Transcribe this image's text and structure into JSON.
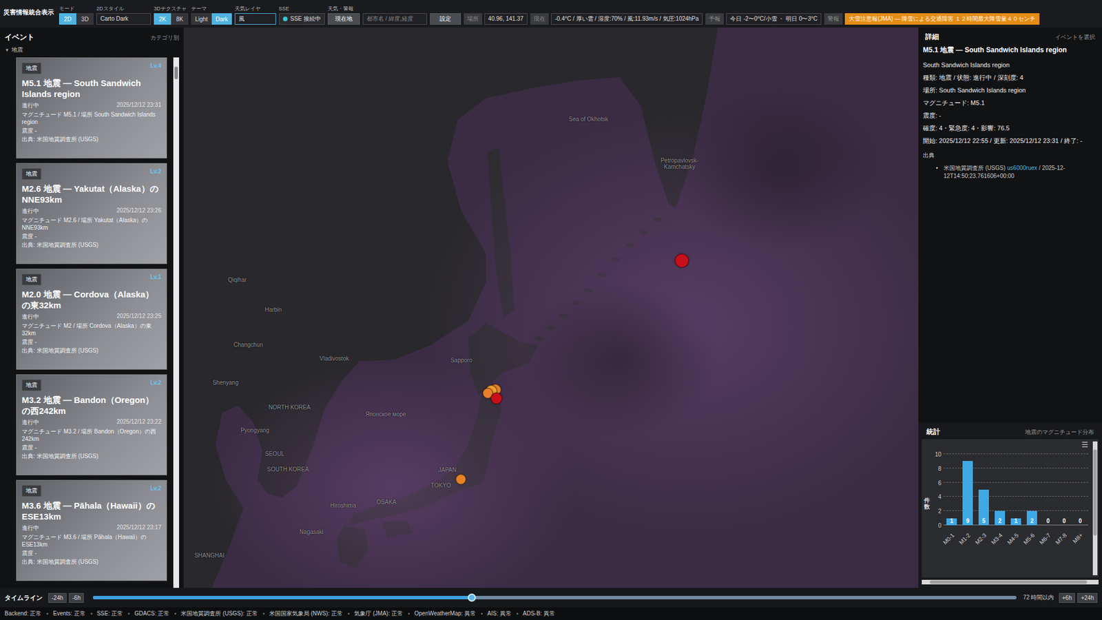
{
  "window": {
    "title": "災害情報統合表示"
  },
  "toolbar": {
    "controls": [
      {
        "kind": "toggle",
        "label": "モード",
        "options": [
          {
            "label": "2D",
            "selected": true
          },
          {
            "label": "3D",
            "selected": false
          }
        ]
      },
      {
        "kind": "select",
        "label": "2Dスタイル",
        "value": "Carto Dark"
      },
      {
        "kind": "toggle",
        "label": "3Dテクスチャ",
        "options": [
          {
            "label": "2K",
            "selected": true
          },
          {
            "label": "8K",
            "selected": false
          }
        ]
      },
      {
        "kind": "toggle",
        "label": "テーマ",
        "options": [
          {
            "label": "Light",
            "selected": false
          },
          {
            "label": "Dark",
            "selected": true
          }
        ]
      },
      {
        "kind": "input",
        "label": "天気レイヤ",
        "value": "風"
      },
      {
        "kind": "status",
        "label": "SSE",
        "value": "SSE 接続中",
        "connected": true
      }
    ],
    "weather": {
      "label": "天気・警報",
      "locateButton": "現在地",
      "placeholder": "都市名 / 緯度,経度",
      "setButton": "設定",
      "fields": [
        {
          "kind": "info",
          "label": "場所",
          "value": "40.96, 141.37"
        },
        {
          "kind": "info",
          "label": "現在",
          "value": "-0.4°C / 厚い雲 / 湿度:70% / 風:11.93m/s / 気圧:1024hPa"
        },
        {
          "kind": "info",
          "label": "予報",
          "value": "今日 -2〜0°C/小雪 ・ 明日 0〜3°C"
        },
        {
          "kind": "alert",
          "label": "警報",
          "value": "大雪注意報(JMA) — 降雪による交通障害 １２時間最大降雪量４０センチ"
        }
      ]
    }
  },
  "events": {
    "title": "イベント",
    "grouping": "カテゴリ別",
    "category": {
      "toggle": "▾",
      "label": "地震",
      "expanded": true
    },
    "items": [
      {
        "tag": "地震",
        "level": "Lv.4",
        "title": "M5.1 地震 — South Sandwich Islands region",
        "status": "進行中",
        "time": "2025/12/12 23:31",
        "detail": "マグニチュード M5.1 / 場所 South Sandwich Islands region",
        "intensity": "震度 -",
        "source": "出典: 米国地質調査所 (USGS)"
      },
      {
        "tag": "地震",
        "level": "Lv.2",
        "title": "M2.6 地震 — Yakutat（Alaska）のNNE93km",
        "status": "進行中",
        "time": "2025/12/12 23:26",
        "detail": "マグニチュード M2.6 / 場所 Yakutat（Alaska）のNNE93km",
        "intensity": "震度 -",
        "source": "出典: 米国地質調査所 (USGS)"
      },
      {
        "tag": "地震",
        "level": "Lv.1",
        "title": "M2.0 地震 — Cordova（Alaska）の東32km",
        "status": "進行中",
        "time": "2025/12/12 23:25",
        "detail": "マグニチュード M2 / 場所 Cordova（Alaska）の東32km",
        "intensity": "震度 -",
        "source": "出典: 米国地質調査所 (USGS)"
      },
      {
        "tag": "地震",
        "level": "Lv.2",
        "title": "M3.2 地震 — Bandon（Oregon）の西242km",
        "status": "進行中",
        "time": "2025/12/12 23:22",
        "detail": "マグニチュード M3.2 / 場所 Bandon（Oregon）の西242km",
        "intensity": "震度 -",
        "source": "出典: 米国地質調査所 (USGS)"
      },
      {
        "tag": "地震",
        "level": "Lv.2",
        "title": "M3.6 地震 — Pāhala（Hawaii）のESE13km",
        "status": "進行中",
        "time": "2025/12/12 23:17",
        "detail": "マグニチュード M3.6 / 場所 Pāhala（Hawaii）のESE13km",
        "intensity": "震度 -",
        "source": "出典: 米国地質調査所 (USGS)"
      }
    ]
  },
  "map": {
    "labels": [
      "Sea of Okhotsk",
      "Petropavlovsk-Kamchatsky",
      "Qiqihar",
      "Harbin",
      "Changchun",
      "Vladivostok",
      "Shenyang",
      "Sapporo",
      "NORTH KOREA",
      "Японское море",
      "Pyongyang",
      "SEOUL",
      "SOUTH KOREA",
      "JAPAN",
      "TOKYO",
      "Hiroshima",
      "OSAKA",
      "Nagasaki",
      "SHANGHAI"
    ],
    "markers": [
      {
        "color": "#c8101c"
      },
      {
        "color": "#e8822a"
      },
      {
        "color": "#f0a030"
      },
      {
        "color": "#e8822a"
      },
      {
        "color": "#c8101c"
      },
      {
        "color": "#e8822a"
      }
    ]
  },
  "detail": {
    "title": "詳細",
    "hint": "イベントを選択",
    "heading": "M5.1 地震 — South Sandwich Islands region",
    "subheading": "South Sandwich Islands region",
    "lines": [
      "種類: 地震 / 状態: 進行中 / 深刻度: 4",
      "場所: South Sandwich Islands region",
      "マグニチュード: M5.1",
      "震度: -",
      "確度: 4・緊急度: 4・影響: 76.5",
      "開始: 2025/12/12 22:55 / 更新: 2025/12/12 23:31 / 終了: -"
    ],
    "sourcesTitle": "出典",
    "sources": [
      {
        "name": "米国地質調査所 (USGS)",
        "id": "us6000ruex",
        "time": "/ 2025-12-12T14:50:23.761606+00:00"
      }
    ]
  },
  "stats": {
    "title": "統計",
    "subtitle": "地震のマグニチュード分布",
    "menuIcon": "☰",
    "yAxisTitle": "件数",
    "yTicks": [
      "0",
      "2",
      "4",
      "6",
      "8",
      "10"
    ],
    "yMax": 10,
    "categories": [
      "M0-1",
      "M1-2",
      "M2-3",
      "M3-4",
      "M4-5",
      "M5-6",
      "M6-7",
      "M7-8",
      "M8+"
    ],
    "values": [
      1,
      9,
      5,
      2,
      1,
      2,
      0,
      0,
      0
    ],
    "valueLabels": [
      "1",
      "9",
      "5",
      "2",
      "1",
      "2",
      "0",
      "0",
      "0"
    ]
  },
  "timeline": {
    "label": "タイムライン",
    "backButtons": [
      "-24h",
      "-6h"
    ],
    "level": 0.41,
    "range": "72 時間以内",
    "forwardButtons": [
      "+6h",
      "+24h"
    ]
  },
  "statusBar": [
    "Backend: 正常",
    "Events: 正常",
    "SSE: 正常",
    "GDACS: 正常",
    "米国地質調査所 (USGS): 正常",
    "米国国家気象局 (NWS): 正常",
    "気象庁 (JMA): 正常",
    "OpenWeatherMap: 異常",
    "AIS: 異常",
    "ADS-B: 異常"
  ]
}
